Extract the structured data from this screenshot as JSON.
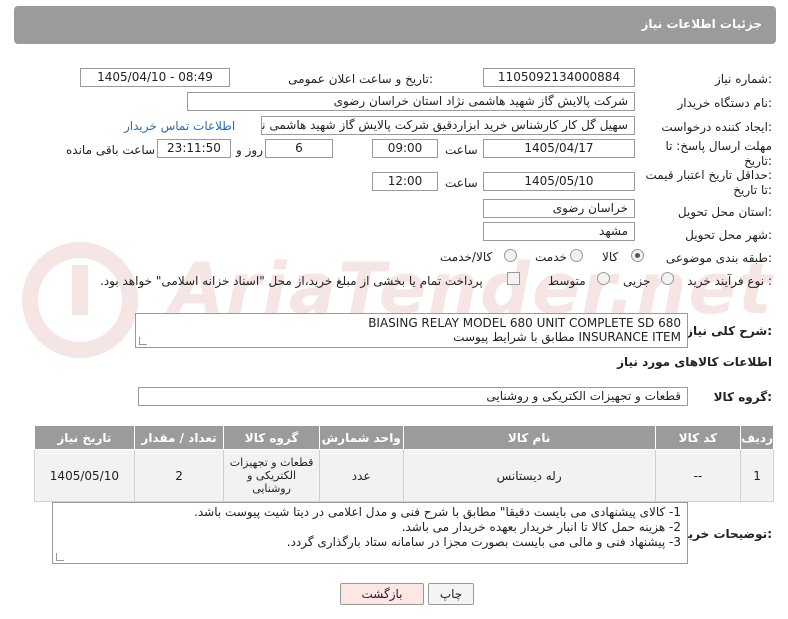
{
  "header": {
    "title": "جزئیات اطلاعات نیاز"
  },
  "fields": {
    "need_number_label": "شماره نیاز:",
    "need_number": "1105092134000884",
    "announce_label": "تاریخ و ساعت اعلان عمومی:",
    "announce_value": "1405/04/10 - 08:49",
    "buyer_org_label": "نام دستگاه خریدار:",
    "buyer_org": "شرکت پالایش گاز شهید هاشمی نژاد   استان خراسان رضوی",
    "creator_label": "ایجاد کننده درخواست:",
    "creator": "سهیل گل کار کارشناس خرید ابزاردقیق شرکت پالایش گاز شهید هاشمی نژاد",
    "contact_link": "اطلاعات تماس خریدار",
    "reply_deadline_label_1": "مهلت ارسال پاسخ: تا",
    "reply_deadline_label_2": "تاریخ:",
    "reply_date": "1405/04/17",
    "time_label": "ساعت",
    "reply_time": "09:00",
    "days_value": "6",
    "days_label": "روز و",
    "remaining_time": "23:11:50",
    "remaining_label": "ساعت باقی مانده",
    "price_validity_label_1": "حداقل تاریخ اعتبار قیمت:",
    "price_validity_label_2": "تا تاریخ:",
    "price_date": "1405/05/10",
    "price_time": "12:00",
    "province_label": "استان محل تحویل:",
    "province": "خراسان رضوی",
    "city_label": "شهر محل تحویل:",
    "city": "مشهد",
    "category_label": "طبقه بندی موضوعی:",
    "category_options": [
      "کالا",
      "خدمت",
      "کالا/خدمت"
    ],
    "category_selected": "کالا",
    "process_label": "نوع فرآیند خرید :",
    "process_options": [
      "جزیی",
      "متوسط"
    ],
    "process_selected": "جزیی",
    "payment_note": "پرداخت تمام یا بخشی از مبلغ خرید،از محل \"اسناد خزانه اسلامی\" خواهد بود.",
    "description_label": "شرح کلی نیاز:",
    "description_line1": "BIASING RELAY MODEL 680 UNIT COMPLETE SD 680",
    "description_line2": "INSURANCE ITEM مطابق با شرایط پیوست",
    "goods_info_title": "اطلاعات کالاهای مورد نیاز",
    "goods_group_label": "گروه کالا:",
    "goods_group": "قطعات و تجهیزات الکتریکی و روشنایی"
  },
  "table": {
    "headers": [
      "ردیف",
      "کد کالا",
      "نام کالا",
      "واحد شمارش",
      "گروه کالا",
      "تعداد / مقدار",
      "تاریخ نیاز"
    ],
    "rows": [
      [
        "1",
        "--",
        "رله دیستانس",
        "عدد",
        "قطعات و تجهیزات الکتریکی و روشنایی",
        "2",
        "1405/05/10"
      ]
    ]
  },
  "buyer_notes": {
    "label": "توضیحات خریدار:",
    "lines": [
      "1-    کالای پیشنهادی می بایست دقیقا\" مطابق با شرح فنی و مدل اعلامی در دیتا شیت پیوست باشد.",
      "2-    هزینه حمل کالا تا انبار خریدار بعهده خریدار می باشد.",
      "3-    پیشنهاد فنی و مالی می بایست بصورت مجزا در سامانه ستاد بارگذاری گردد."
    ]
  },
  "buttons": {
    "print": "چاپ",
    "back": "بازگشت"
  },
  "watermark": {
    "text": "AriaTender.net"
  }
}
